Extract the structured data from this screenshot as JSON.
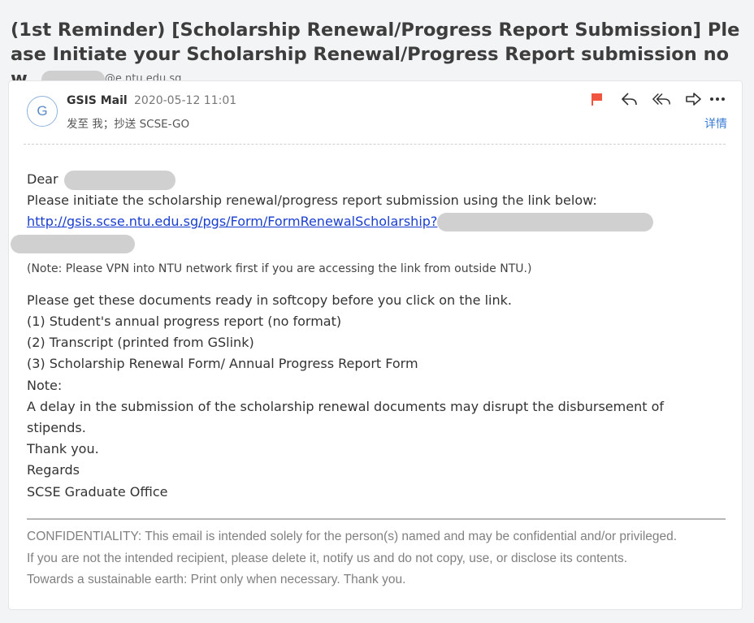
{
  "email": {
    "subject": "(1st Reminder) [Scholarship Renewal/Progress Report Submission] Please Initiate your Scholarship Renewal/Progress Report submission now.",
    "sender_domain": "@e.ntu.edu.sg",
    "avatar_letter": "G",
    "from_name": "GSIS Mail",
    "date": "2020-05-12 11:01",
    "recipients": "发至 我；抄送 SCSE-GO",
    "details_label": "详情",
    "actions": {
      "flag_icon": "flag-icon",
      "reply_icon": "reply-icon",
      "reply_all_icon": "reply-all-icon",
      "forward_icon": "forward-icon",
      "more_icon": "more-icon",
      "flag_color": "#f0563f"
    }
  },
  "body": {
    "greeting": "Dear",
    "intro": "Please initiate the scholarship renewal/progress report submission using the link below:",
    "link": "http://gsis.scse.ntu.edu.sg/pgs/Form/FormRenewalScholarship?",
    "vpn_note": "(Note: Please VPN into NTU network first if you are accessing the link from outside NTU.)",
    "docs_intro": "Please get these documents ready in softcopy before you click on the link.",
    "docs": [
      "(1) Student's annual progress report (no format)",
      "(2) Transcript (printed from GSlink)",
      "(3) Scholarship Renewal Form/ Annual Progress Report Form"
    ],
    "note_label": "Note:",
    "note_text": "A delay in the submission of the scholarship renewal documents may disrupt the disbursement of stipends.",
    "thanks": "Thank you.",
    "regards": "Regards",
    "signature": "SCSE Graduate Office"
  },
  "footer": {
    "line1": "CONFIDENTIALITY: This email is intended solely for the person(s) named and may be confidential and/or privileged.",
    "line2": "If you are not the intended recipient, please delete it, notify us and do not copy, use, or disclose its contents.",
    "line3": "Towards a sustainable earth: Print only when necessary. Thank you."
  }
}
